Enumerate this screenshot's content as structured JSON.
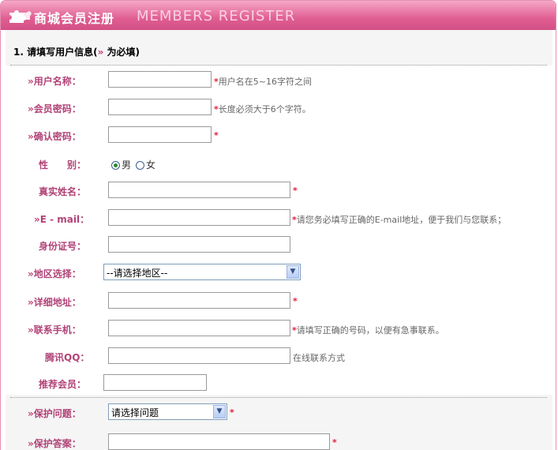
{
  "header": {
    "title_cn": "商城会员注册",
    "title_en": "MEMBERS REGISTER"
  },
  "section": {
    "prefix": "1. 请填写用户信息(",
    "chev": "»",
    "suffix": " 为必填)"
  },
  "fields": {
    "username": {
      "label": "用户名称：",
      "star": "*",
      "hint": "用户名在5~16字符之间"
    },
    "password": {
      "label": "会员密码：",
      "star": "*",
      "hint": "长度必须大于6个字符。"
    },
    "confirm": {
      "label": "确认密码：",
      "star": "*"
    },
    "gender": {
      "label": "性　　别：",
      "male": "男",
      "female": "女"
    },
    "realname": {
      "label": "真实姓名：",
      "star": "*"
    },
    "email": {
      "label": "E - mail：",
      "star": "*",
      "hint": "请您务必填写正确的E-mail地址，便于我们与您联系；"
    },
    "idcard": {
      "label": "身份证号："
    },
    "region": {
      "label": "地区选择：",
      "selected": "--请选择地区--"
    },
    "address": {
      "label": "详细地址：",
      "star": "*"
    },
    "mobile": {
      "label": "联系手机：",
      "star": "*",
      "hint": "请填写正确的号码，以便有急事联系。"
    },
    "qq": {
      "label": "腾讯QQ：",
      "hint": "在线联系方式"
    },
    "referrer": {
      "label": "推荐会员："
    },
    "question": {
      "label": "保护问题：",
      "selected": "请选择问题",
      "star": "*"
    },
    "answer": {
      "label": "保护答案：",
      "star": "*"
    }
  },
  "chev": "»",
  "colors": {
    "header": "#e05f93",
    "label": "#b14377",
    "star": "#e0203a"
  }
}
